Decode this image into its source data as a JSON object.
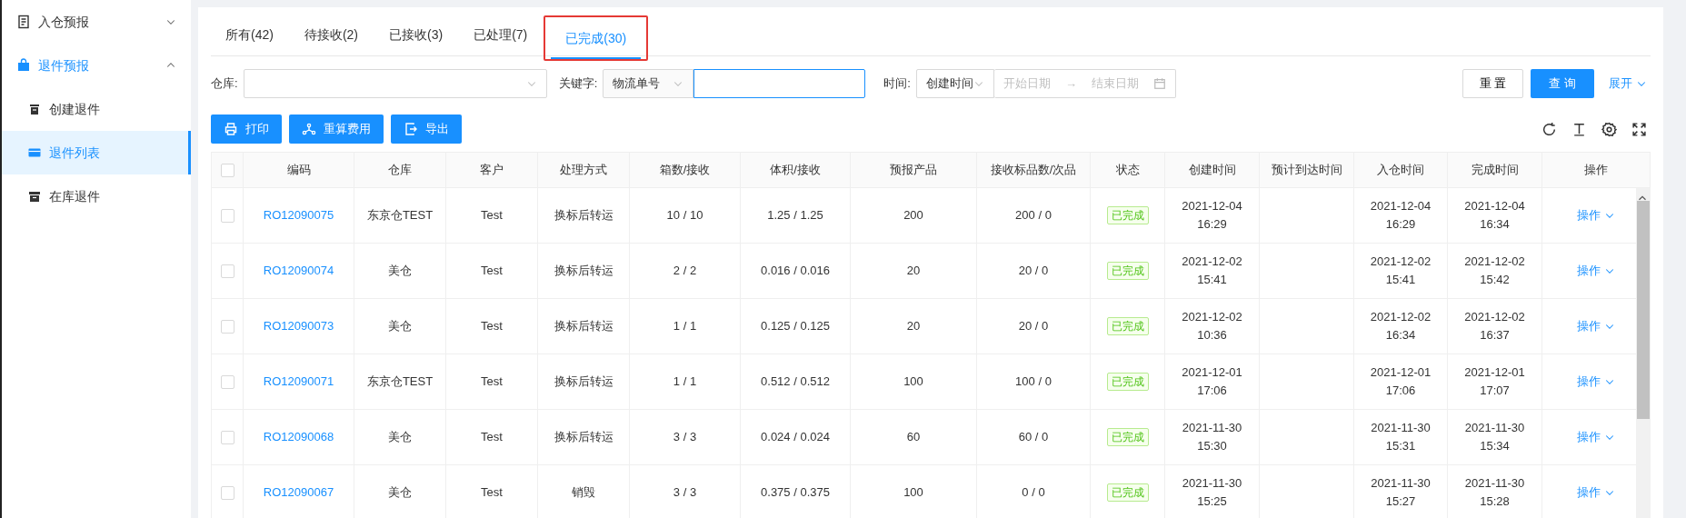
{
  "sidebar": {
    "items": [
      {
        "label": "入仓预报",
        "selected": false,
        "expanded": false
      },
      {
        "label": "退件预报",
        "selected": true,
        "expanded": true,
        "children": [
          {
            "label": "创建退件",
            "selected": false
          },
          {
            "label": "退件列表",
            "selected": true
          },
          {
            "label": "在库退件",
            "selected": false
          }
        ]
      }
    ]
  },
  "tabs": [
    {
      "label": "所有(42)",
      "selected": false,
      "highlighted": false
    },
    {
      "label": "待接收(2)",
      "selected": false,
      "highlighted": false
    },
    {
      "label": "已接收(3)",
      "selected": false,
      "highlighted": false
    },
    {
      "label": "已处理(7)",
      "selected": false,
      "highlighted": false
    },
    {
      "label": "已完成(30)",
      "selected": true,
      "highlighted": true
    }
  ],
  "filters": {
    "warehouse": {
      "label": "仓库:"
    },
    "keyword": {
      "label": "关键字:",
      "type": "物流单号"
    },
    "time": {
      "label": "时间:",
      "type": "创建时间",
      "start_placeholder": "开始日期",
      "separator": "→",
      "end_placeholder": "结束日期"
    },
    "reset": "重 置",
    "query": "查 询",
    "expand": "展开"
  },
  "toolbar": [
    {
      "label": "打印"
    },
    {
      "label": "重算费用"
    },
    {
      "label": "导出"
    }
  ],
  "table": {
    "columns": [
      "编码",
      "仓库",
      "客户",
      "处理方式",
      "箱数/接收",
      "体积/接收",
      "预报产品",
      "接收标品数/次品",
      "状态",
      "创建时间",
      "预计到达时间",
      "入仓时间",
      "完成时间",
      "操作"
    ],
    "header_checked": false,
    "rows": [
      {
        "checked": false,
        "cells": [
          "RO12090075",
          "东京仓TEST",
          "Test",
          "换标后转运",
          "10 / 10",
          "1.25 / 1.25",
          "200",
          "200 / 0",
          "已完成",
          "2021-12-04 16:29",
          null,
          "2021-12-04 16:29",
          "2021-12-04 16:34",
          "操作"
        ]
      },
      {
        "checked": false,
        "cells": [
          "RO12090074",
          "美仓",
          "Test",
          "换标后转运",
          "2 / 2",
          "0.016 / 0.016",
          "20",
          "20 / 0",
          "已完成",
          "2021-12-02 15:41",
          null,
          "2021-12-02 15:41",
          "2021-12-02 15:42",
          "操作"
        ]
      },
      {
        "checked": false,
        "cells": [
          "RO12090073",
          "美仓",
          "Test",
          "换标后转运",
          "1 / 1",
          "0.125 / 0.125",
          "20",
          "20 / 0",
          "已完成",
          "2021-12-02 10:36",
          null,
          "2021-12-02 16:34",
          "2021-12-02 16:37",
          "操作"
        ]
      },
      {
        "checked": false,
        "cells": [
          "RO12090071",
          "东京仓TEST",
          "Test",
          "换标后转运",
          "1 / 1",
          "0.512 / 0.512",
          "100",
          "100 / 0",
          "已完成",
          "2021-12-01 17:06",
          null,
          "2021-12-01 17:06",
          "2021-12-01 17:07",
          "操作"
        ]
      },
      {
        "checked": false,
        "cells": [
          "RO12090068",
          "美仓",
          "Test",
          "换标后转运",
          "3 / 3",
          "0.024 / 0.024",
          "60",
          "60 / 0",
          "已完成",
          "2021-11-30 15:30",
          null,
          "2021-11-30 15:31",
          "2021-11-30 15:34",
          "操作"
        ]
      },
      {
        "checked": false,
        "cells": [
          "RO12090067",
          "美仓",
          "Test",
          "销毁",
          "3 / 3",
          "0.375 / 0.375",
          "100",
          "0 / 0",
          "已完成",
          "2021-11-30 15:25",
          null,
          "2021-11-30 15:27",
          "2021-11-30 15:28",
          "操作"
        ]
      }
    ]
  }
}
